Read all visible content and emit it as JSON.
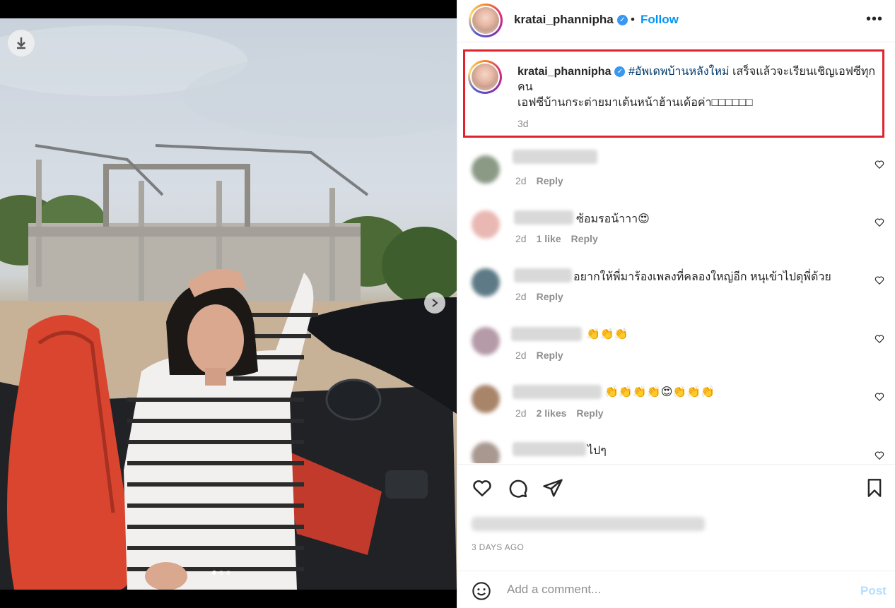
{
  "header": {
    "username": "kratai_phannipha",
    "separator": "•",
    "follow_label": "Follow",
    "more_label": "•••"
  },
  "caption": {
    "username": "kratai_phannipha",
    "hashtag": "#อัพเดพบ้านหลังใหม่",
    "text_line1": " เสร็จแล้วจะเรียนเชิญเอฟซีทุกคน",
    "text_line2": "เอฟซีบ้านกระต่ายมาเต้นหน้าฮ้านเด้อค่า□□□□□□",
    "time": "3d"
  },
  "comments": [
    {
      "text": "",
      "time": "2d",
      "likes": "",
      "reply": "Reply",
      "avatar_color": "#8a9a85",
      "name_width": 120
    },
    {
      "text": "ซ้อมรอน้าาา😍",
      "time": "2d",
      "likes": "1 like",
      "reply": "Reply",
      "avatar_color": "#e9b8b2",
      "name_width": 84
    },
    {
      "text": "อยากให้พี่มาร้องเพลงที่คลองใหญ่อีก หนุเข้าไปดุพี่ด้วย",
      "time": "2d",
      "likes": "",
      "reply": "Reply",
      "avatar_color": "#5d7a86",
      "name_width": 82
    },
    {
      "text": "👏👏👏",
      "time": "2d",
      "likes": "",
      "reply": "Reply",
      "avatar_color": "#b59aa8",
      "name_width": 100
    },
    {
      "text": "👏👏👏👏😍👏👏👏",
      "time": "2d",
      "likes": "2 likes",
      "reply": "Reply",
      "avatar_color": "#a88469",
      "name_width": 126
    },
    {
      "text": "ไปๆ",
      "time": "",
      "likes": "",
      "reply": "",
      "avatar_color": "#a89890",
      "name_width": 104
    }
  ],
  "footer": {
    "date": "3 DAYS AGO",
    "comment_placeholder": "Add a comment...",
    "post_label": "Post"
  },
  "icons": [
    "download-icon",
    "chevron-right-icon",
    "heart-icon",
    "comment-icon",
    "share-icon",
    "bookmark-icon",
    "emoji-icon",
    "verified-icon",
    "more-icon"
  ]
}
